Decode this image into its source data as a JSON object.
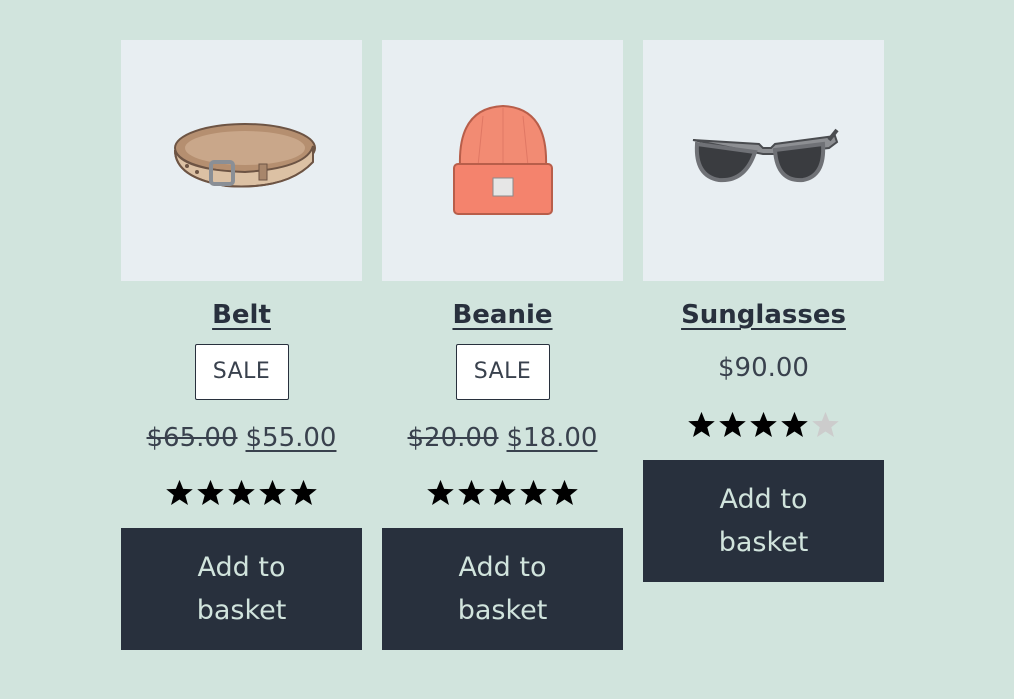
{
  "products": [
    {
      "name": "Belt",
      "badge": "SALE",
      "regular_price": "$65.00",
      "sale_price": "$55.00",
      "rating": 5,
      "button": "Add to basket",
      "image_icon": "belt-image"
    },
    {
      "name": "Beanie",
      "badge": "SALE",
      "regular_price": "$20.00",
      "sale_price": "$18.00",
      "rating": 5,
      "button": "Add to basket",
      "image_icon": "beanie-image"
    },
    {
      "name": "Sunglasses",
      "price": "$90.00",
      "rating": 4,
      "button": "Add to basket",
      "image_icon": "sunglasses-image"
    }
  ],
  "colors": {
    "background": "#d1e4dd",
    "button": "#28303d",
    "button_text": "#d1e4dd",
    "thumb_bg": "#e8eef2",
    "star_filled": "#000000",
    "star_empty": "#cccccc"
  }
}
